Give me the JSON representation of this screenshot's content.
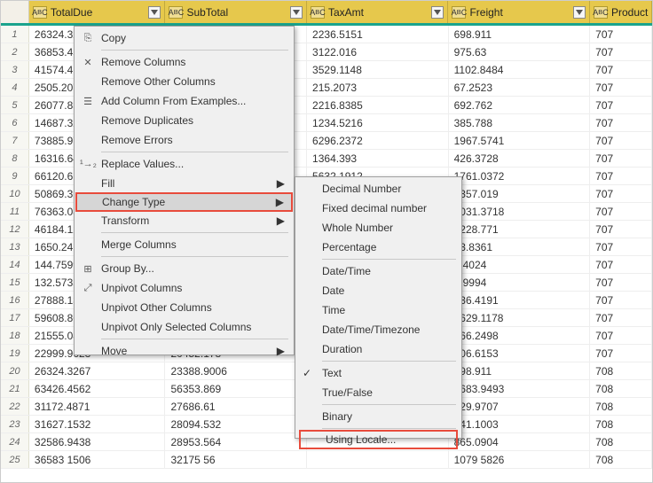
{
  "columns": [
    {
      "label": "TotalDue",
      "type": "ABC"
    },
    {
      "label": "SubTotal",
      "type": "ABC"
    },
    {
      "label": "TaxAmt",
      "type": "ABC"
    },
    {
      "label": "Freight",
      "type": "ABC"
    },
    {
      "label": "Product",
      "type": "ABC"
    }
  ],
  "rows": [
    {
      "n": "1",
      "c": [
        "26324.32",
        "",
        "2236.5151",
        "698.911",
        "707"
      ]
    },
    {
      "n": "2",
      "c": [
        "36853.45",
        "",
        "3122.016",
        "975.63",
        "707"
      ]
    },
    {
      "n": "3",
      "c": [
        "41574.41",
        "",
        "3529.1148",
        "1102.8484",
        "707"
      ]
    },
    {
      "n": "4",
      "c": [
        "2505.207",
        "",
        "215.2073",
        "67.2523",
        "707"
      ]
    },
    {
      "n": "5",
      "c": [
        "26077.83",
        "",
        "2216.8385",
        "692.762",
        "707"
      ]
    },
    {
      "n": "6",
      "c": [
        "14687.32",
        "",
        "1234.5216",
        "385.788",
        "707"
      ]
    },
    {
      "n": "7",
      "c": [
        "73885.97",
        "",
        "6296.2372",
        "1967.5741",
        "707"
      ]
    },
    {
      "n": "8",
      "c": [
        "16316.64",
        "",
        "1364.393",
        "426.3728",
        "707"
      ]
    },
    {
      "n": "9",
      "c": [
        "66120.61",
        "",
        "5632.1912",
        "1761.0372",
        "707"
      ]
    },
    {
      "n": "10",
      "c": [
        "50869.3",
        "",
        "",
        "1357.019",
        "707"
      ]
    },
    {
      "n": "11",
      "c": [
        "76363.08",
        "",
        "",
        "2031.3718",
        "707"
      ]
    },
    {
      "n": "12",
      "c": [
        "46184.12",
        "",
        "",
        "1228.771",
        "707"
      ]
    },
    {
      "n": "13",
      "c": [
        "1650.241",
        "",
        "",
        "43.8361",
        "707"
      ]
    },
    {
      "n": "14",
      "c": [
        "144.7599",
        "",
        "",
        "3.4024",
        "707"
      ]
    },
    {
      "n": "15",
      "c": [
        "132.5735",
        "",
        "",
        "2.9994",
        "707"
      ]
    },
    {
      "n": "16",
      "c": [
        "27888.13",
        "",
        "",
        "736.4191",
        "707"
      ]
    },
    {
      "n": "17",
      "c": [
        "59608.86",
        "",
        "",
        "1629.1178",
        "707"
      ]
    },
    {
      "n": "18",
      "c": [
        "21555.08",
        "",
        "",
        "566.2498",
        "707"
      ]
    },
    {
      "n": "19",
      "c": [
        "22999.9623",
        "20452.178",
        "",
        "606.6153",
        "707"
      ]
    },
    {
      "n": "20",
      "c": [
        "26324.3267",
        "23388.9006",
        "",
        "698.911",
        "708"
      ]
    },
    {
      "n": "21",
      "c": [
        "63426.4562",
        "56353.869",
        "",
        "1683.9493",
        "708"
      ]
    },
    {
      "n": "22",
      "c": [
        "31172.4871",
        "27686.61",
        "",
        "829.9707",
        "708"
      ]
    },
    {
      "n": "23",
      "c": [
        "31627.1532",
        "28094.532",
        "",
        "841.1003",
        "708"
      ]
    },
    {
      "n": "24",
      "c": [
        "32586.9438",
        "28953.564",
        "",
        "865.0904",
        "708"
      ]
    },
    {
      "n": "25",
      "c": [
        "36583 1506",
        "32175 56",
        "",
        "1079 5826",
        "708"
      ]
    }
  ],
  "menu": {
    "copy": "Copy",
    "removeCols": "Remove Columns",
    "removeOther": "Remove Other Columns",
    "addColEx": "Add Column From Examples...",
    "removeDup": "Remove Duplicates",
    "removeErr": "Remove Errors",
    "replaceVal": "Replace Values...",
    "fill": "Fill",
    "changeType": "Change Type",
    "transform": "Transform",
    "mergeCols": "Merge Columns",
    "groupBy": "Group By...",
    "unpivot": "Unpivot Columns",
    "unpivotOther": "Unpivot Other Columns",
    "unpivotSel": "Unpivot Only Selected Columns",
    "move": "Move"
  },
  "submenu": {
    "decimal": "Decimal Number",
    "fixed": "Fixed decimal number",
    "whole": "Whole Number",
    "percentage": "Percentage",
    "datetime": "Date/Time",
    "date": "Date",
    "time": "Time",
    "dttz": "Date/Time/Timezone",
    "duration": "Duration",
    "text": "Text",
    "truefalse": "True/False",
    "binary": "Binary",
    "locale": "Using Locale..."
  }
}
